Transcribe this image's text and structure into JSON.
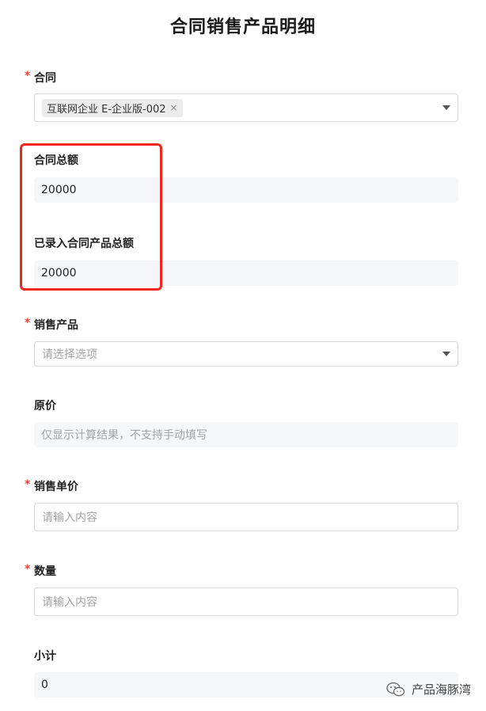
{
  "page": {
    "title": "合同销售产品明细"
  },
  "fields": {
    "contract": {
      "label": "合同",
      "required_mark": "*",
      "tag": "互联网企业 E-企业版-002",
      "tag_remove": "×"
    },
    "contract_total": {
      "label": "合同总额",
      "value": "20000"
    },
    "recorded_total": {
      "label": "已录入合同产品总额",
      "value": "20000"
    },
    "product": {
      "label": "销售产品",
      "required_mark": "*",
      "placeholder": "请选择选项"
    },
    "original_price": {
      "label": "原价",
      "placeholder": "仅显示计算结果，不支持手动填写"
    },
    "unit_price": {
      "label": "销售单价",
      "required_mark": "*",
      "placeholder": "请输入内容"
    },
    "quantity": {
      "label": "数量",
      "required_mark": "*",
      "placeholder": "请输入内容"
    },
    "subtotal": {
      "label": "小计",
      "value": "0"
    }
  },
  "watermark": {
    "text": "产品海豚湾",
    "icon": "wechat-icon"
  },
  "colors": {
    "required": "#f0443a",
    "highlight_box": "#f3261e",
    "readonly_bg": "#f6f7f8"
  }
}
